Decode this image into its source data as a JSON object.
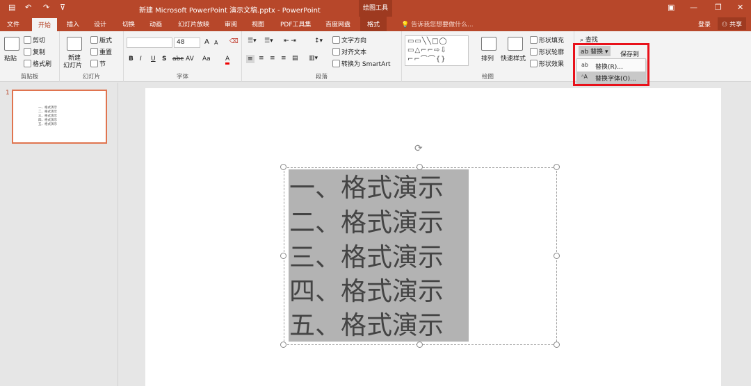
{
  "titlebar": {
    "save_icon": "save-icon",
    "undo": "↶",
    "redo": "↷",
    "customize": "⊽",
    "title": "新建 Microsoft PowerPoint 演示文稿.pptx - PowerPoint",
    "context_group": "绘图工具",
    "controls": [
      "▣",
      "—",
      "❐",
      "✕"
    ]
  },
  "tabs": [
    "文件",
    "开始",
    "插入",
    "设计",
    "切换",
    "动画",
    "幻灯片放映",
    "审阅",
    "视图",
    "PDF工具集",
    "百度网盘",
    "格式"
  ],
  "active_tab": "开始",
  "tell_me": "告诉我您想要做什么...",
  "login": "登录",
  "share": "共享",
  "clipboard": {
    "paste": "粘贴",
    "cut": "剪切",
    "copy": "复制",
    "format_painter": "格式刷",
    "label": "剪贴板"
  },
  "slides_group": {
    "new_slide_1": "新建",
    "new_slide_2": "幻灯片",
    "layout": "版式",
    "reset": "重置",
    "section": "节",
    "label": "幻灯片"
  },
  "font_group": {
    "font_name": "",
    "font_size": "48",
    "grow": "A",
    "shrink": "A",
    "clear": "⌫",
    "bold": "B",
    "italic": "I",
    "underline": "U",
    "shadow": "S",
    "strike": "abc",
    "spacing": "AV",
    "case": "Aa",
    "color": "A",
    "label": "字体"
  },
  "paragraph": {
    "text_direction": "文字方向",
    "align_text": "对齐文本",
    "smartart": "转换为 SmartArt",
    "label": "段落"
  },
  "drawing": {
    "shapes_rows": [
      "▭▭╲╲□◯",
      "▭△⌐⌐⇨⇩",
      "⌐⌐⌒⌒{}"
    ],
    "arrange": "排列",
    "quick_styles": "快速样式",
    "fill": "形状填充",
    "outline": "形状轮廓",
    "effects": "形状效果",
    "label": "绘图"
  },
  "editing": {
    "find": "查找",
    "replace": "替换",
    "save_to": "保存到"
  },
  "dropdown": {
    "replace": "替换(R)...",
    "replace_fonts": "替换字体(O)..."
  },
  "slide_panel": {
    "number": "1",
    "thumb_lines": [
      "一、格式演示",
      "二、格式演示",
      "三、格式演示",
      "四、格式演示",
      "五、格式演示"
    ]
  },
  "slide": {
    "lines": [
      "一、格式演示",
      "二、格式演示",
      "三、格式演示",
      "四、格式演示",
      "五、格式演示"
    ]
  },
  "colors": {
    "accent": "#b7472a",
    "highlight": "#e8111a"
  }
}
